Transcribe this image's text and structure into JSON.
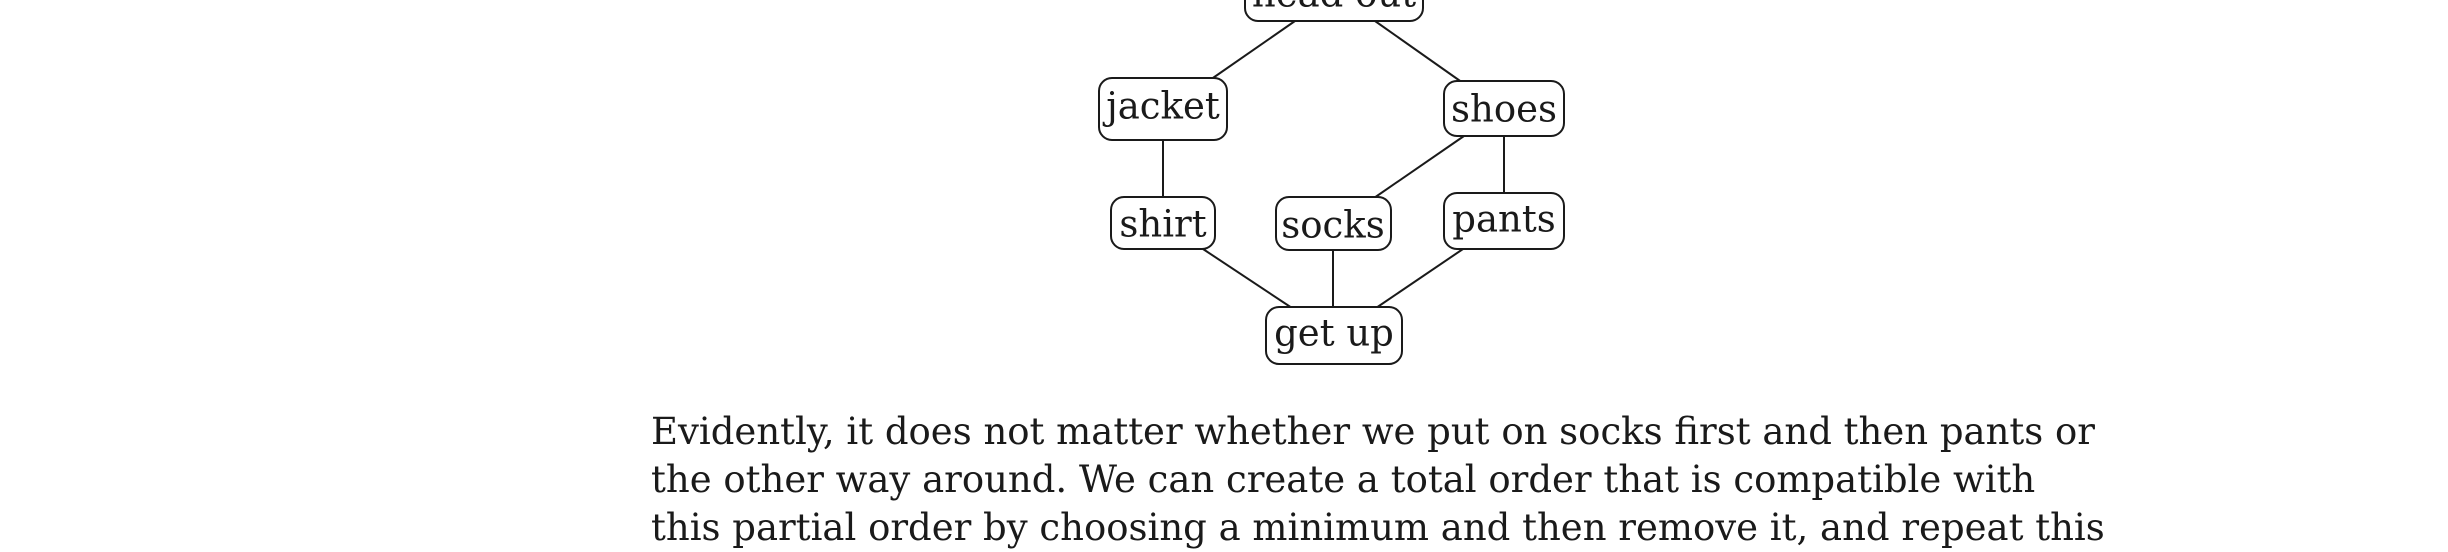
{
  "diagram": {
    "nodes": {
      "head_out": "head out",
      "jacket": "jacket",
      "shoes": "shoes",
      "shirt": "shirt",
      "socks": "socks",
      "pants": "pants",
      "get_up": "get up"
    }
  },
  "paragraph": {
    "lines": [
      "Evidently, it does not matter whether we put on socks first and then pants or",
      "the other way around.  We can create a total order that is compatible with",
      "this partial order by choosing a minimum and then remove it, and repeat this"
    ]
  }
}
